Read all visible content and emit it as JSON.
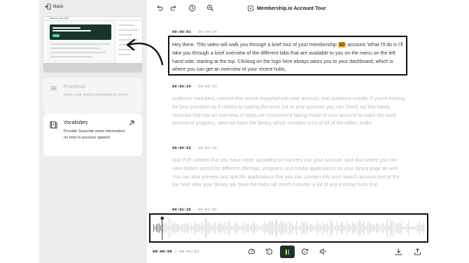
{
  "left_panel": {
    "back_label": "Back",
    "thumbnail_title": "Welcome, Lodge Violet!",
    "cards": [
      {
        "icon": "people-icon",
        "title": "Proofread",
        "description": "Have your media proofread by a Pro."
      },
      {
        "icon": "book-icon",
        "title": "Vocabulary",
        "description": "Provide Searchie more information on how to process speech."
      }
    ]
  },
  "toolbar": {
    "title": "Membership.io Account Tour"
  },
  "transcript": {
    "segments": [
      {
        "start": "00:00:01",
        "end": "00:00:24",
        "text_before": "Hey there. This video will walk you through a brief tour of your membership ",
        "highlight": "IO",
        "text_after": " account. What I'll do is I'll take you through a brief overview of the different tabs that are available to you on the menu on the left hand side, starting at the top. Clicking on the logo here always takes you to your dashboard, which is where you can get an overview of your recent hubs,"
      },
      {
        "start": "00:00:24",
        "end": "00:00:53",
        "text": "audience members, content that you've imported into your account, and audience activity. If you're looking for best practices as it relates to making the most out of your account, you can check out this handy checklist that has an overview of steps we recommend taking inside of your account to make the most amount of progress. Next we have the library, which contains a list of all of the video, audio"
      },
      {
        "start": "00:00:53",
        "end": "00:01:26",
        "text": "and PDF content that you have either uploaded or imported into your account, and also where you can view folders sorted by different offerings, programs and media applications on your library page as well. You can also preview any specific applications that you can connect into your search account just at the top here after your library, we have the hubs tab which includes a list of any existing hubs that"
      },
      {
        "start": "00:01:26",
        "end": "00:01:54",
        "text": ""
      }
    ]
  },
  "player": {
    "current_time": "00:00:06",
    "total_time": "00:03:33",
    "progress": 0.028
  },
  "colors": {
    "accent_dark": "#17352d",
    "highlight": "#f7b733",
    "play_icon": "#ffd74a"
  }
}
